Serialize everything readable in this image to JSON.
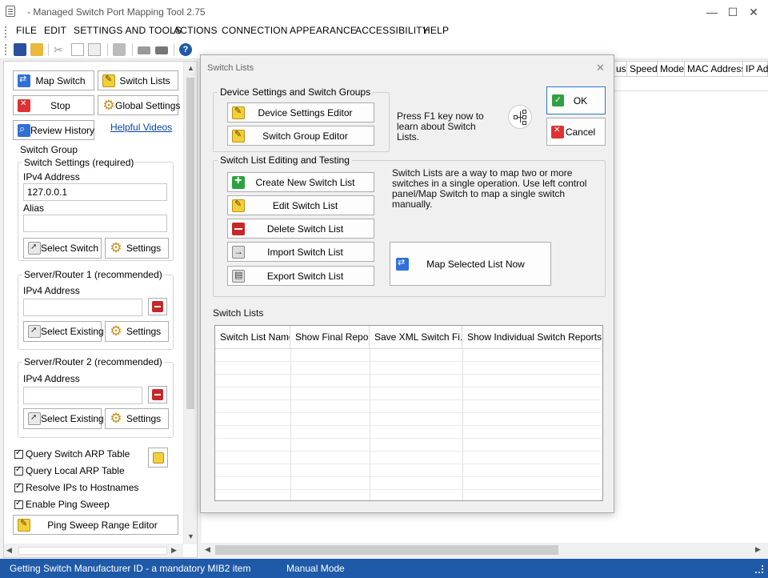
{
  "window": {
    "title": "- Managed Switch Port Mapping Tool 2.75",
    "minimize": "—",
    "maximize": "☐",
    "close": "✕"
  },
  "menu": [
    "FILE",
    "EDIT",
    "SETTINGS AND TOOLS",
    "ACTIONS",
    "CONNECTION",
    "APPEARANCE",
    "ACCESSIBILITY",
    "HELP"
  ],
  "left": {
    "map_switch": "Map Switch",
    "switch_lists": "Switch Lists",
    "stop": "Stop",
    "global_settings": "Global Settings",
    "review_history": "Review History",
    "helpful_videos": "Helpful Videos",
    "switch_group": "Switch Group",
    "switch_settings": "Switch Settings (required)",
    "ipv4_label": "IPv4 Address",
    "ipv4_value": "127.0.0.1",
    "alias_label": "Alias",
    "alias_value": "",
    "select_switch": "Select Switch",
    "settings": "Settings",
    "router1_title": "Server/Router 1 (recommended)",
    "router1_ipv4_label": "IPv4 Address",
    "router1_ipv4_value": "",
    "select_existing": "Select Existing",
    "router2_title": "Server/Router 2 (recommended)",
    "router2_ipv4_label": "IPv4 Address",
    "router2_ipv4_value": "",
    "checks": [
      {
        "label": "Query Switch ARP Table",
        "checked": true
      },
      {
        "label": "Query Local ARP Table",
        "checked": true
      },
      {
        "label": "Resolve IPs to Hostnames",
        "checked": true
      },
      {
        "label": "Enable Ping Sweep",
        "checked": true
      }
    ],
    "ping_sweep_editor": "Ping Sweep Range Editor"
  },
  "main_columns": [
    "us",
    "Speed",
    "Mode",
    "MAC Address",
    "IP Ad"
  ],
  "dialog": {
    "title": "Switch Lists",
    "close": "✕",
    "group1_title": "Device Settings and Switch Groups",
    "device_settings_editor": "Device Settings Editor",
    "switch_group_editor": "Switch Group Editor",
    "help_text": "Press F1 key now to learn about Switch Lists.",
    "ok": "OK",
    "cancel": "Cancel",
    "group2_title": "Switch List Editing and Testing",
    "create": "Create New Switch List",
    "edit": "Edit Switch List",
    "delete": "Delete Switch List",
    "import": "Import Switch List",
    "export": "Export Switch List",
    "description": "Switch Lists are a way to map two or more switches in a single operation. Use left control panel/Map Switch to map a single switch manually.",
    "map_selected": "Map Selected List Now",
    "lists_label": "Switch Lists",
    "table_headers": [
      "Switch List Name",
      "Show Final Report",
      "Save XML Switch Fi...",
      "Show Individual Switch Reports"
    ]
  },
  "status": {
    "message": "Getting Switch Manufacturer ID - a mandatory MIB2 item",
    "mode": "Manual Mode"
  }
}
